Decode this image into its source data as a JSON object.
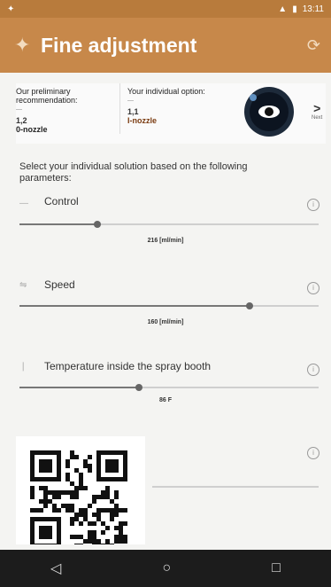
{
  "status_bar": {
    "time": "13:11"
  },
  "app_bar": {
    "title": "Fine adjustment",
    "back_icon": "back-arrow-icon",
    "refresh_icon": "refresh-icon",
    "color": "#c7884a"
  },
  "recommendation": {
    "preliminary": {
      "label": "Our preliminary recommendation:",
      "value": "1,2",
      "nozzle": "0-nozzle"
    },
    "individual": {
      "label": "Your individual option:",
      "value": "1,1",
      "nozzle": "I-nozzle"
    },
    "next_label": "Next"
  },
  "instructions": "Select your individual solution based on the following parameters:",
  "params": [
    {
      "label": "Control",
      "icon": "control-icon",
      "value_text": "216 [ml/min]",
      "level": 0.26
    },
    {
      "label": "Speed",
      "icon": "speed-icon",
      "value_text": "160 [ml/min]",
      "level": 0.77
    },
    {
      "label": "Temperature inside the spray booth",
      "icon": "thermometer-icon",
      "value_text": "86 F",
      "level": 0.4
    }
  ]
}
